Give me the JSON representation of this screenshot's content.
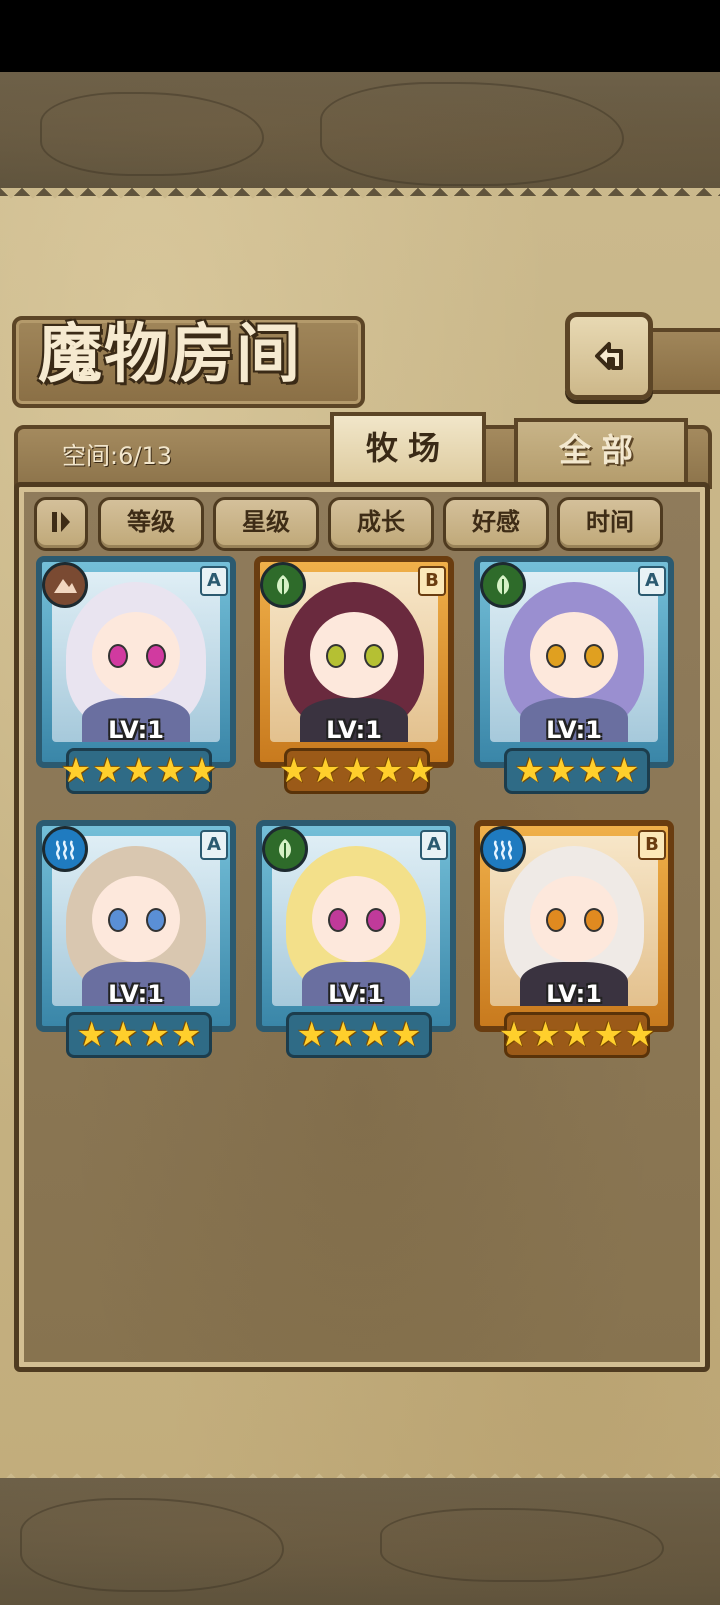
{
  "header": {
    "title": "魔物房间",
    "back_icon": "back-arrow-icon"
  },
  "tabs": {
    "space_label": "空间:6/13",
    "pasture": "牧场",
    "all": "全部",
    "active": "牧场"
  },
  "sort_bar": {
    "toggle_icon": "pause-sort-icon",
    "buttons": [
      "等级",
      "星级",
      "成长",
      "好感",
      "时间"
    ]
  },
  "monsters": [
    {
      "level": "LV:1",
      "grade": "A",
      "element": "earth",
      "element_color": "#7a4a32",
      "frame": "blue",
      "stars": 5,
      "hair": "#e9e4f0",
      "eye": "#d13aa0"
    },
    {
      "level": "LV:1",
      "grade": "B",
      "element": "nature",
      "element_color": "#2e6b2a",
      "frame": "gold",
      "stars": 5,
      "hair": "#6a2a3e",
      "eye": "#b5c033"
    },
    {
      "level": "LV:1",
      "grade": "A",
      "element": "nature",
      "element_color": "#2e6b2a",
      "frame": "blue",
      "stars": 4,
      "hair": "#9a8fd0",
      "eye": "#e0a020"
    },
    {
      "level": "LV:1",
      "grade": "A",
      "element": "water",
      "element_color": "#1f7bc0",
      "frame": "blue",
      "stars": 4,
      "hair": "#d9c7b0",
      "eye": "#5a8fd6"
    },
    {
      "level": "LV:1",
      "grade": "A",
      "element": "nature",
      "element_color": "#2e6b2a",
      "frame": "blue",
      "stars": 4,
      "hair": "#f3e08a",
      "eye": "#c03a9a"
    },
    {
      "level": "LV:1",
      "grade": "B",
      "element": "water",
      "element_color": "#1f7bc0",
      "frame": "gold",
      "stars": 5,
      "hair": "#efeae6",
      "eye": "#e08a20"
    }
  ]
}
